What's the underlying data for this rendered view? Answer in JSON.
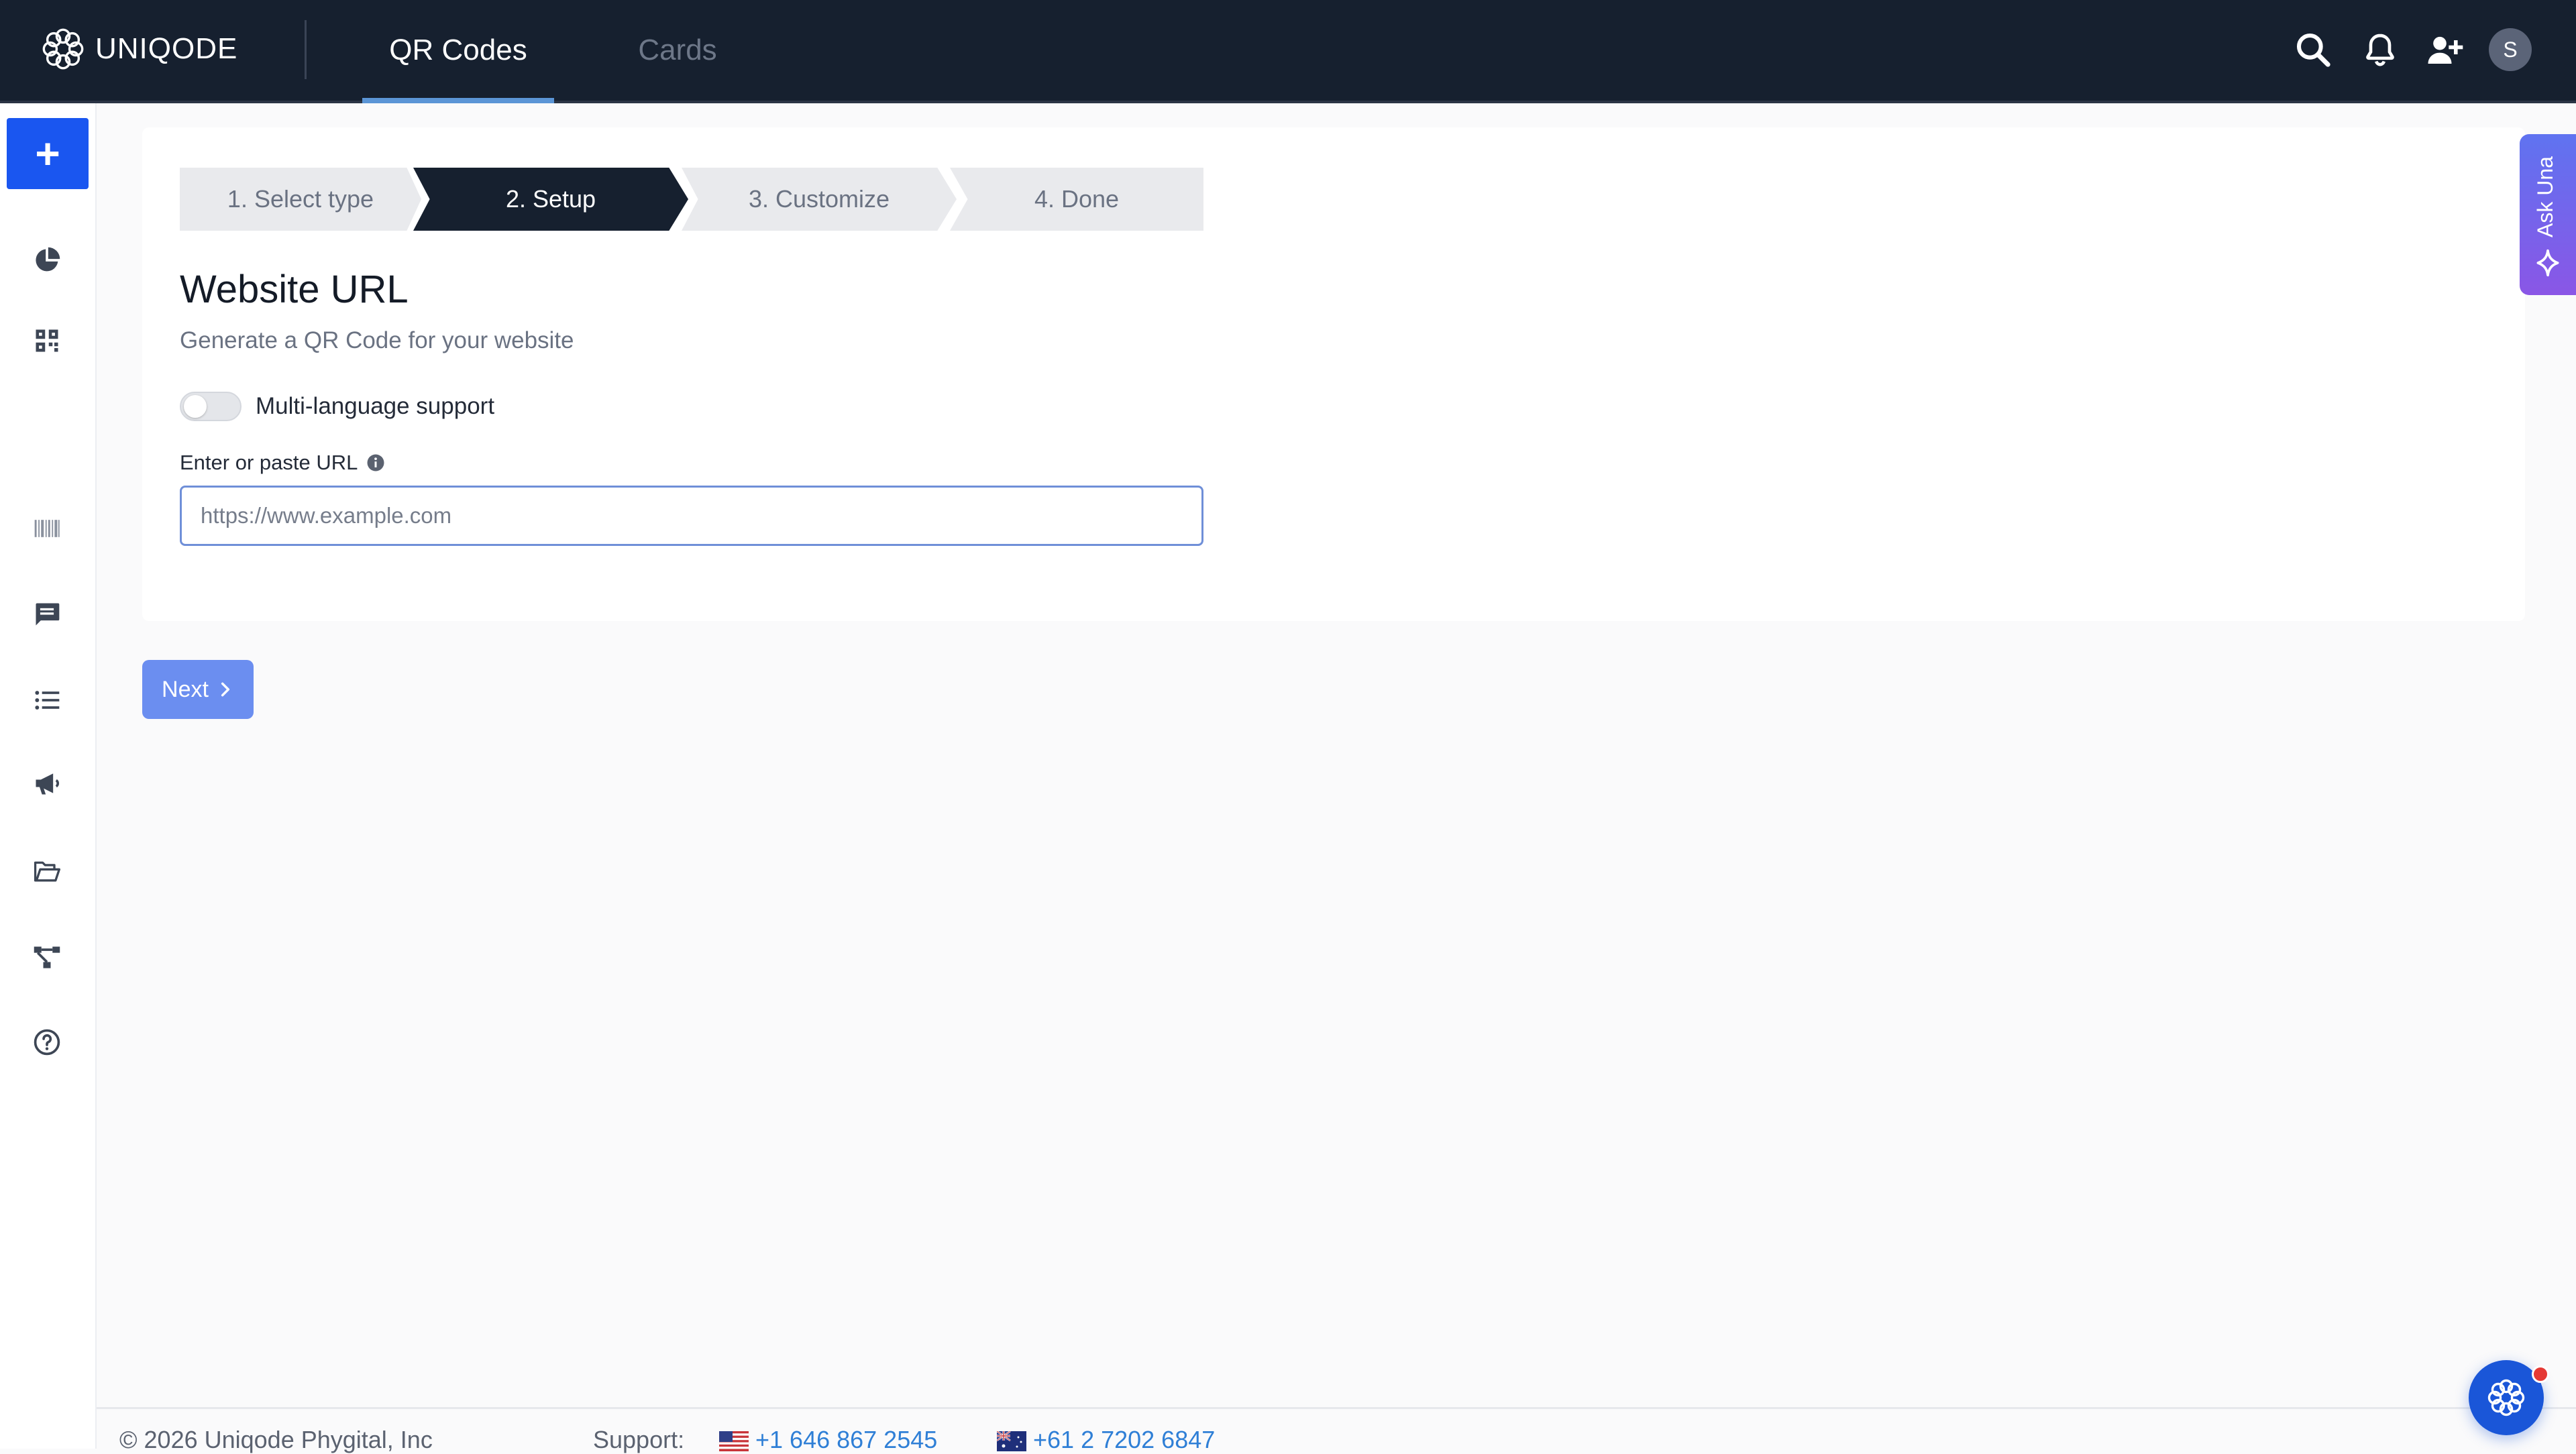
{
  "brand": {
    "name": "UNIQODE"
  },
  "nav": {
    "tabs": [
      {
        "label": "QR Codes",
        "active": true
      },
      {
        "label": "Cards",
        "active": false
      }
    ],
    "avatar_initial": "S"
  },
  "sidebar": {
    "add_label": "+",
    "icons": [
      "analytics-icon",
      "qr-code-icon",
      "barcode-icon",
      "message-icon",
      "list-icon",
      "megaphone-icon",
      "folder-icon",
      "workflow-icon",
      "help-icon"
    ]
  },
  "stepper": {
    "steps": [
      "1. Select type",
      "2. Setup",
      "3. Customize",
      "4. Done"
    ],
    "active_index": 1
  },
  "form": {
    "title": "Website URL",
    "subtitle": "Generate a QR Code for your website",
    "toggle_label": "Multi-language support",
    "toggle_on": false,
    "url_label": "Enter or paste URL",
    "url_placeholder": "https://www.example.com",
    "url_value": ""
  },
  "actions": {
    "next_label": "Next"
  },
  "ask_una": {
    "label": "Ask Una"
  },
  "footer": {
    "copyright": "© 2026 Uniqode Phygital, Inc",
    "support_label": "Support:",
    "phone_us": "+1 646 867 2545",
    "phone_au": "+61 2 7202 6847"
  },
  "colors": {
    "topbar": "#16202f",
    "primary": "#1a56f0",
    "next_button": "#6b8ef0",
    "link": "#2f7fd6",
    "ask_una_gradient_start": "#5f73f0",
    "ask_una_gradient_end": "#8a56e6"
  }
}
